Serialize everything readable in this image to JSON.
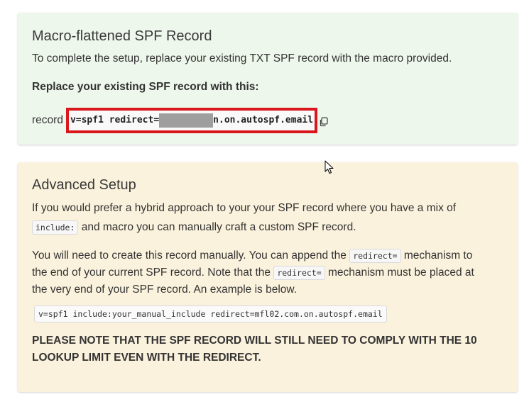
{
  "spf_card": {
    "title": "Macro-flattened SPF Record",
    "intro": "To complete the setup, replace your existing TXT SPF record with the macro provided.",
    "subheading": "Replace your existing SPF record with this:",
    "record_label": "record",
    "record_prefix": "v=spf1 redirect=",
    "record_suffix": "n.on.autospf.email",
    "copy_icon": "copy-icon",
    "highlight_color": "#d9171c"
  },
  "advanced_card": {
    "title": "Advanced Setup",
    "para1_a": "If you would prefer a hybrid approach to your your SPF record where you have a mix of",
    "para1_code": "include:",
    "para1_b": "and macro you can manually craft a custom SPF record.",
    "para2_a": "You will need to create this record manually. You can append the",
    "para2_code1": "redirect=",
    "para2_b": "mechanism to",
    "para2_c": "the end of your current SPF record. Note that the",
    "para2_code2": "redirect=",
    "para2_d": "mechanism must be placed at",
    "para2_e": "the very end of your SPF record. An example is below.",
    "example": "v=spf1 include:your_manual_include redirect=mfl02.com.on.autospf.email",
    "note": "PLEASE NOTE THAT THE SPF RECORD WILL STILL NEED TO COMPLY WITH THE 10 LOOKUP LIMIT EVEN WITH THE REDIRECT."
  },
  "colors": {
    "spf_card_bg": "#eef7ec",
    "advanced_card_bg": "#fbf2dd"
  }
}
